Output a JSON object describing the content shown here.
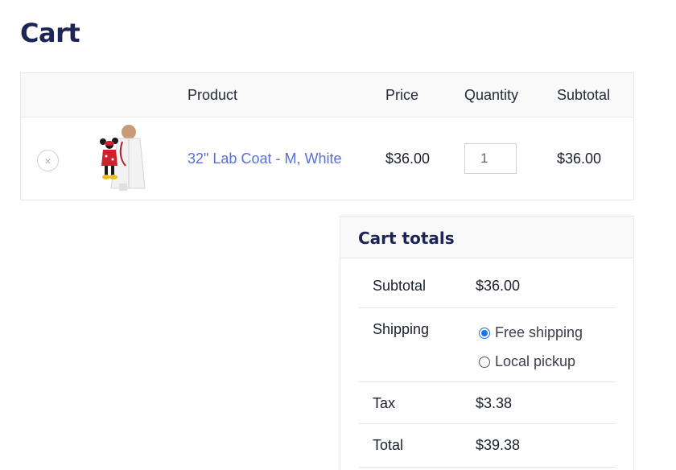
{
  "page": {
    "title": "Cart"
  },
  "cart": {
    "headers": {
      "product": "Product",
      "price": "Price",
      "quantity": "Quantity",
      "subtotal": "Subtotal"
    },
    "items": [
      {
        "remove_symbol": "×",
        "thumbnail_icon": "lab-coat-product-image",
        "name": "32\" Lab Coat - M, White",
        "price": "$36.00",
        "quantity": "1",
        "subtotal": "$36.00"
      }
    ]
  },
  "totals": {
    "title": "Cart totals",
    "subtotal_label": "Subtotal",
    "subtotal_value": "$36.00",
    "shipping_label": "Shipping",
    "shipping_options": [
      {
        "label": "Free shipping",
        "selected": true
      },
      {
        "label": "Local pickup",
        "selected": false
      }
    ],
    "tax_label": "Tax",
    "tax_value": "$3.38",
    "total_label": "Total",
    "total_value": "$39.38"
  },
  "colors": {
    "title": "#1c2553",
    "link": "#5a6fd8",
    "radio_accent": "#1a73e8"
  }
}
